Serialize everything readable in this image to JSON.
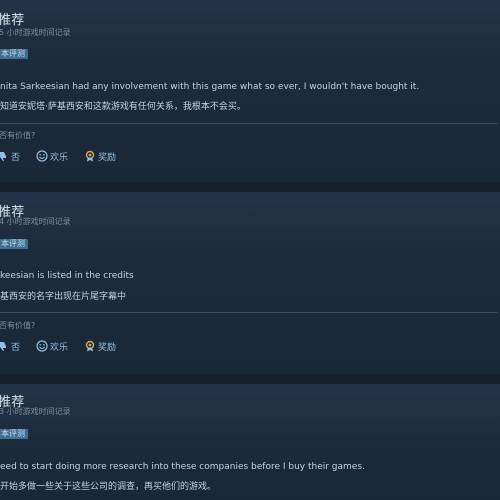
{
  "reviews": [
    {
      "title": "推荐",
      "hours": "5 小时游戏时间记录",
      "badge": "本评测",
      "text_en": "nita Sarkeesian had any involvement with this game what so ever, I wouldn't have bought it.",
      "text_zh": "知道安妮塔·萨基西安和这款游戏有任何关系，我根本不会买。",
      "helpful_prompt": "否有价值?",
      "actions": {
        "no": "否",
        "funny": "欢乐",
        "award": "奖励"
      }
    },
    {
      "title": "推荐",
      "hours": "4 小时游戏时间记录",
      "badge": "本评测",
      "text_en": "keesian is listed in the credits",
      "text_zh": "基西安的名字出现在片尾字幕中",
      "helpful_prompt": "否有价值?",
      "actions": {
        "no": "否",
        "funny": "欢乐",
        "award": "奖励"
      }
    },
    {
      "title": "推荐",
      "hours": "3 小时游戏时间记录",
      "badge": "本评测",
      "text_en": "eed to start doing more research into these companies before I buy their games.",
      "text_zh": "开始多做一些关于这些公司的调查，再买他们的游戏。",
      "helpful_prompt": "",
      "actions": null
    }
  ],
  "colors": {
    "link": "#8fc0e2",
    "badge": "#3e6e93",
    "background": "#1b2838"
  },
  "icons": {
    "no": "thumbs-down-icon",
    "funny": "laugh-icon",
    "award": "award-icon"
  }
}
